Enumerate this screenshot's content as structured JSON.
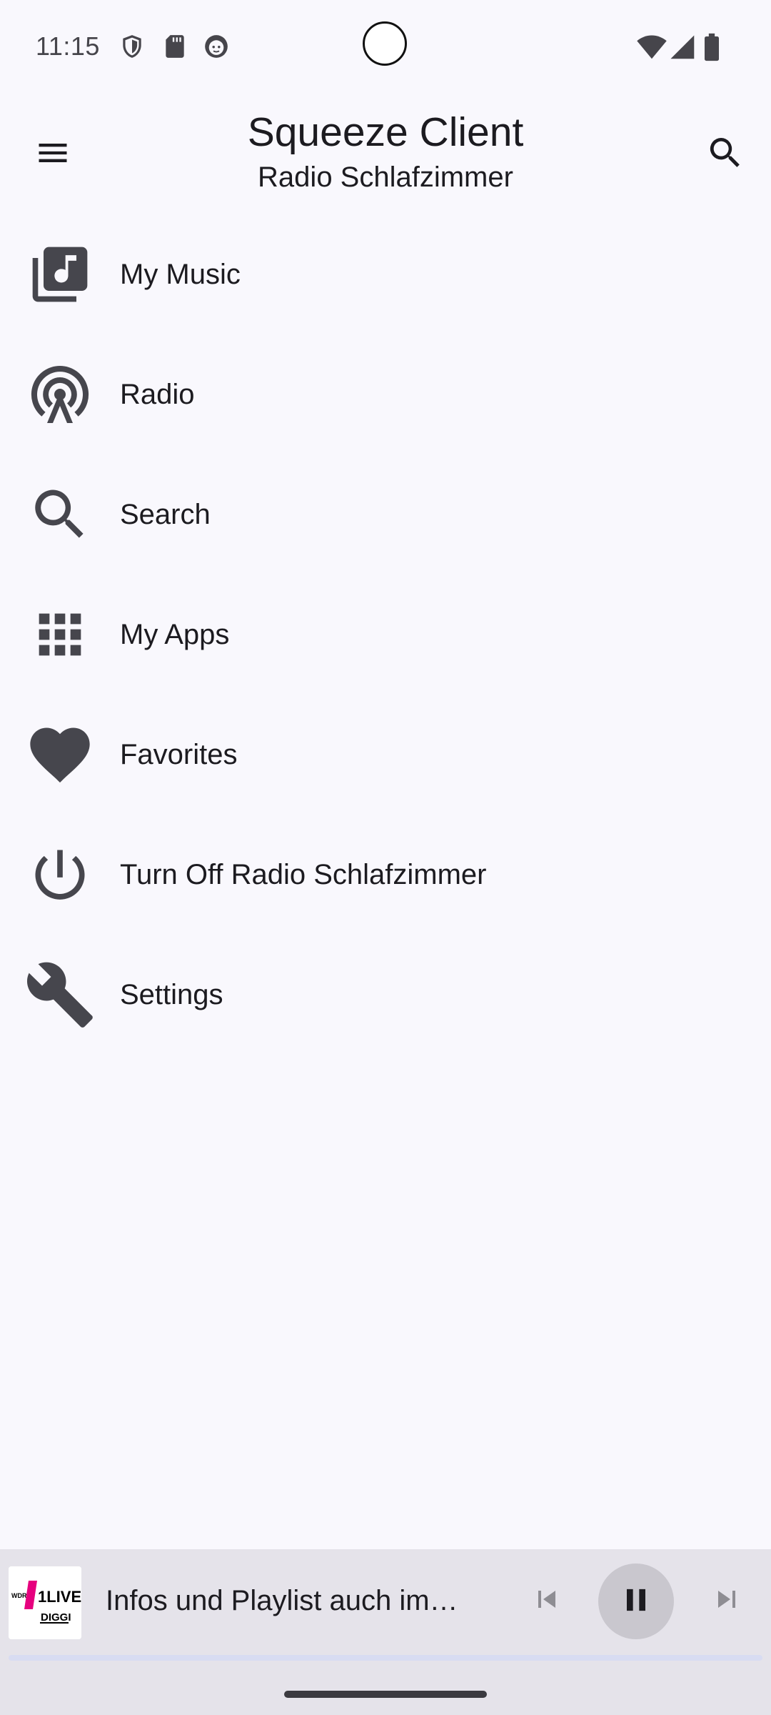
{
  "status_bar": {
    "time": "11:15",
    "icons": [
      "shield-icon",
      "sd-card-icon",
      "face-icon",
      "wifi-icon",
      "signal-icon",
      "battery-icon"
    ]
  },
  "app_bar": {
    "title": "Squeeze Client",
    "subtitle": "Radio Schlafzimmer",
    "menu_icon": "hamburger-menu-icon",
    "search_icon": "search-icon"
  },
  "menu": {
    "items": [
      {
        "label": "My Music",
        "icon": "music-library-icon"
      },
      {
        "label": "Radio",
        "icon": "radio-tower-icon"
      },
      {
        "label": "Search",
        "icon": "search-icon"
      },
      {
        "label": "My Apps",
        "icon": "apps-grid-icon"
      },
      {
        "label": "Favorites",
        "icon": "heart-icon"
      },
      {
        "label": "Turn Off Radio Schlafzimmer",
        "icon": "power-icon"
      },
      {
        "label": "Settings",
        "icon": "wrench-icon"
      }
    ]
  },
  "now_playing": {
    "title": "Infos und Playlist auch im…",
    "album_art": {
      "brand": "WDR",
      "station": "1LIVE",
      "sub": "DIGGI"
    },
    "progress": 0
  },
  "colors": {
    "background": "#f9f8fd",
    "icon": "#46464d",
    "player_bar": "#e5e3ea",
    "accent": "#e6007e"
  }
}
